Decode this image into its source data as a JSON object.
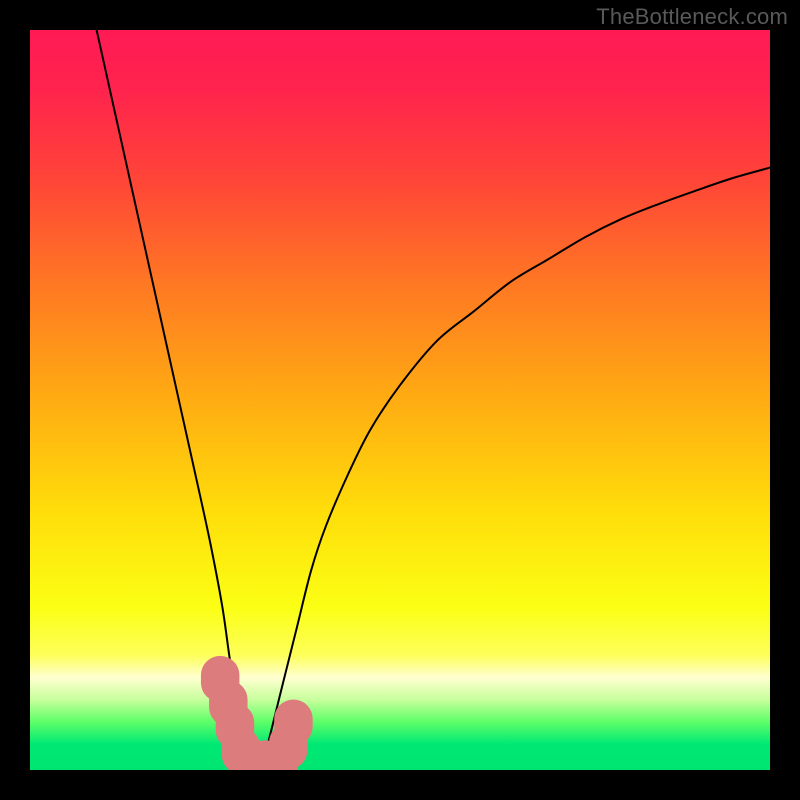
{
  "watermark": "TheBottleneck.com",
  "chart_data": {
    "type": "line",
    "title": "",
    "xlabel": "",
    "ylabel": "",
    "xlim": [
      0,
      100
    ],
    "ylim": [
      0,
      100
    ],
    "gradient_stops": [
      {
        "offset": 0.0,
        "color": "#ff1a54"
      },
      {
        "offset": 0.08,
        "color": "#ff234d"
      },
      {
        "offset": 0.2,
        "color": "#ff4438"
      },
      {
        "offset": 0.35,
        "color": "#ff7a22"
      },
      {
        "offset": 0.5,
        "color": "#ffac12"
      },
      {
        "offset": 0.65,
        "color": "#ffdd0a"
      },
      {
        "offset": 0.78,
        "color": "#fbff14"
      },
      {
        "offset": 0.845,
        "color": "#fdff5a"
      },
      {
        "offset": 0.875,
        "color": "#ffffd0"
      },
      {
        "offset": 0.905,
        "color": "#c7ff9c"
      },
      {
        "offset": 0.935,
        "color": "#5eff68"
      },
      {
        "offset": 0.965,
        "color": "#00e874"
      },
      {
        "offset": 1.0,
        "color": "#00e572"
      }
    ],
    "series": [
      {
        "name": "bottleneck-curve",
        "x": [
          9,
          11,
          13,
          15,
          17,
          19,
          21,
          23,
          24.5,
          26,
          27,
          28,
          29,
          30,
          31,
          32,
          34,
          36,
          38,
          40,
          43,
          46,
          50,
          55,
          60,
          65,
          70,
          75,
          80,
          85,
          90,
          95,
          100
        ],
        "y": [
          100,
          91,
          82,
          73,
          64,
          55,
          46,
          37,
          30,
          22,
          15,
          9,
          4,
          0,
          0,
          3,
          11,
          19,
          27,
          33,
          40,
          46,
          52,
          58,
          62,
          66,
          69,
          72,
          74.5,
          76.5,
          78.3,
          80,
          81.4
        ]
      }
    ],
    "markers": [
      {
        "x": 25.7,
        "y": 12.3,
        "r": 2.6
      },
      {
        "x": 26.8,
        "y": 9.0,
        "r": 2.6
      },
      {
        "x": 27.7,
        "y": 5.9,
        "r": 2.6
      },
      {
        "x": 28.5,
        "y": 2.6,
        "r": 2.6
      },
      {
        "x": 29.9,
        "y": 0.9,
        "r": 2.6
      },
      {
        "x": 31.8,
        "y": 0.9,
        "r": 2.6
      },
      {
        "x": 33.6,
        "y": 0.9,
        "r": 2.6
      },
      {
        "x": 34.9,
        "y": 3.2,
        "r": 2.6
      },
      {
        "x": 35.6,
        "y": 6.4,
        "r": 2.6
      }
    ],
    "annotations": []
  }
}
